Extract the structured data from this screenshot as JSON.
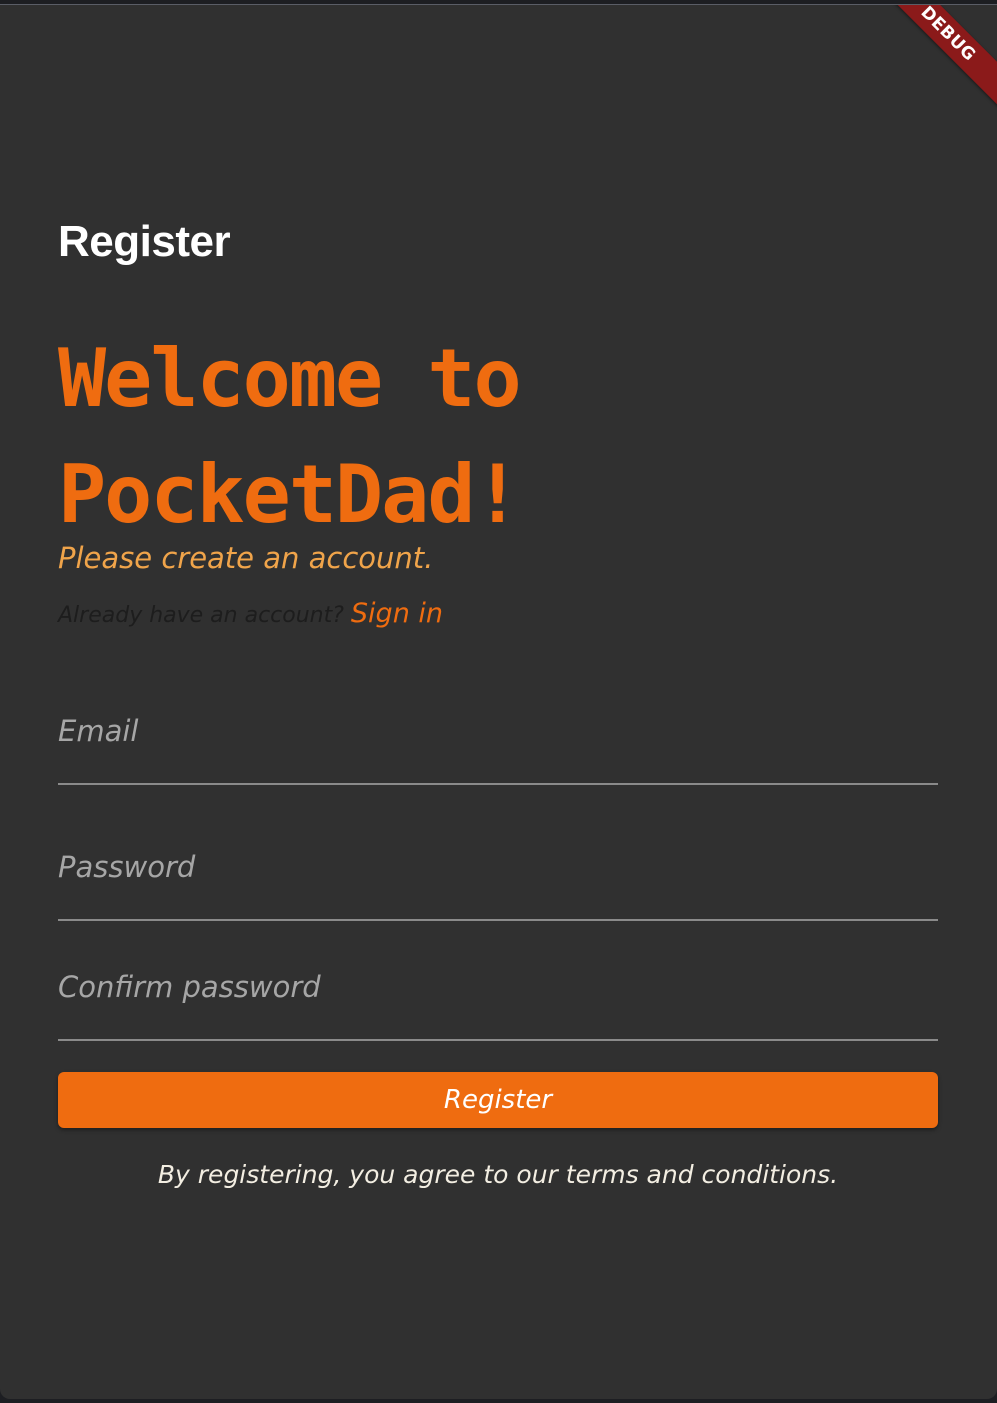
{
  "debug_banner": "DEBUG",
  "header": {
    "title": "Register"
  },
  "welcome": {
    "line1": "Welcome to",
    "line2": "PocketDad!",
    "subtitle": "Please create an account."
  },
  "signin": {
    "prompt": "Already have an account? ",
    "link_label": "Sign in"
  },
  "form": {
    "email_placeholder": "Email",
    "email_value": "",
    "password_placeholder": "Password",
    "password_value": "",
    "confirm_placeholder": "Confirm password",
    "confirm_value": "",
    "submit_label": "Register"
  },
  "terms_text": "By registering, you agree to our terms and conditions.",
  "colors": {
    "background": "#303030",
    "accent": "#ef6c10",
    "subtitle": "#f0a44a",
    "debug_banner": "#8b1a1a"
  }
}
